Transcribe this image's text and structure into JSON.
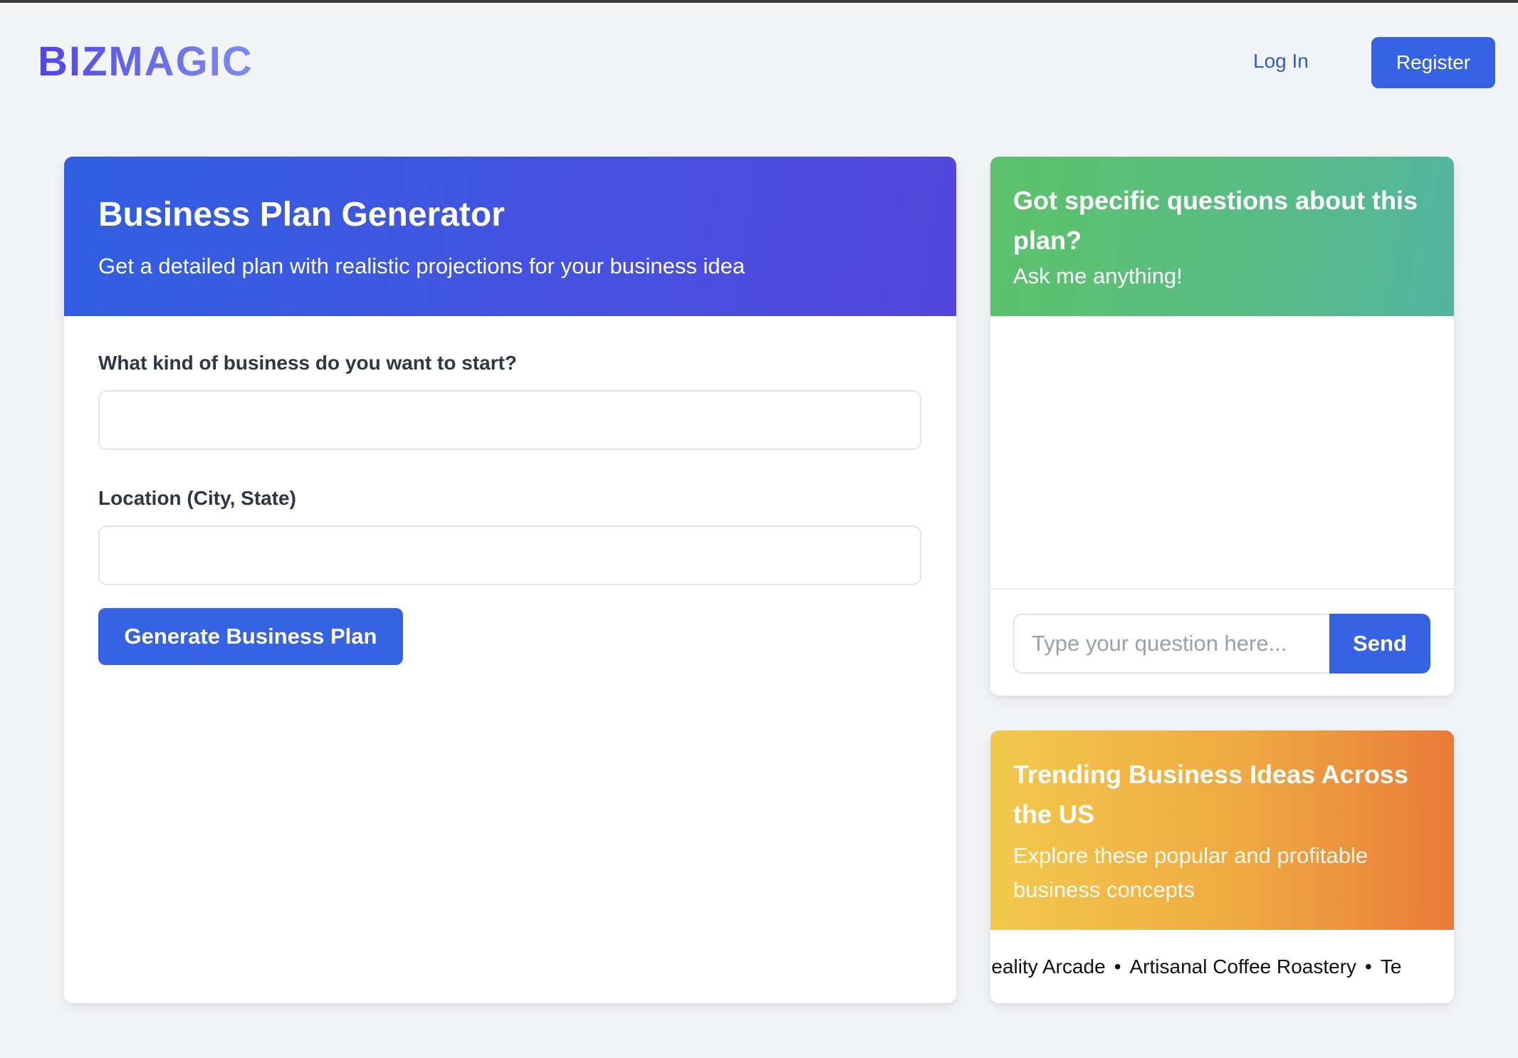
{
  "header": {
    "logo": "BIZMAGIC",
    "login_label": "Log In",
    "register_label": "Register"
  },
  "generator": {
    "title": "Business Plan Generator",
    "subtitle": "Get a detailed plan with realistic projections for your business idea",
    "business_label": "What kind of business do you want to start?",
    "business_value": "",
    "location_label": "Location (City, State)",
    "location_value": "",
    "generate_label": "Generate Business Plan"
  },
  "chat": {
    "title": "Got specific questions about this plan?",
    "subtitle": "Ask me anything!",
    "input_placeholder": "Type your question here...",
    "send_label": "Send"
  },
  "trending": {
    "title": "Trending Business Ideas Across the US",
    "subtitle": "Explore these popular and profitable business concepts",
    "separator": "•",
    "items": [
      "ual Reality Arcade",
      "Artisanal Coffee Roastery",
      "Te"
    ]
  },
  "colors": {
    "accent": "#3563e3",
    "generator_gradient": [
      "#2f5fe0",
      "#5346dc"
    ],
    "chat_gradient": [
      "#5dc26a",
      "#52b4a0"
    ],
    "trending_gradient": [
      "#f2c94c",
      "#e97b38"
    ],
    "background": "#f3f4f6"
  }
}
